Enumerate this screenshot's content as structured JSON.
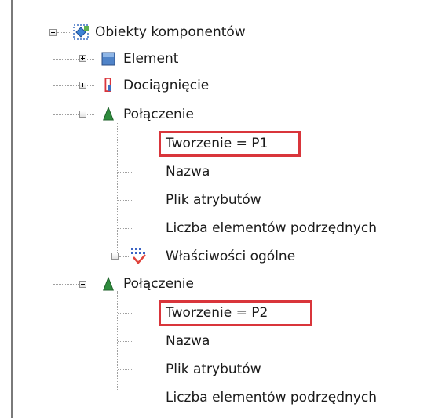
{
  "tree": {
    "root": {
      "label": "Obiekty komponentów",
      "icon": "component-objects-icon",
      "expanded": true
    },
    "nodes": [
      {
        "label": "Element",
        "icon": "element-square-icon",
        "expanded": false
      },
      {
        "label": "Dociągnięcie",
        "icon": "extension-icon",
        "expanded": false
      },
      {
        "label": "Połączenie",
        "icon": "connection-cone-icon",
        "expanded": true,
        "children": [
          {
            "label": "Tworzenie = P1",
            "highlighted": true
          },
          {
            "label": "Nazwa"
          },
          {
            "label": "Plik atrybutów"
          },
          {
            "label": "Liczba elementów podrzędnych"
          },
          {
            "label": "Właściwości ogólne",
            "icon": "general-properties-icon",
            "expanded": false
          }
        ]
      },
      {
        "label": "Połączenie",
        "icon": "connection-cone-icon",
        "expanded": true,
        "children": [
          {
            "label": "Tworzenie = P2",
            "highlighted": true
          },
          {
            "label": "Nazwa"
          },
          {
            "label": "Plik atrybutów"
          },
          {
            "label": "Liczba elementów podrzędnych"
          }
        ]
      }
    ]
  },
  "colors": {
    "highlight": "#d9353b",
    "cone": "#2e8b3d",
    "element_square": "#4f83c8"
  }
}
